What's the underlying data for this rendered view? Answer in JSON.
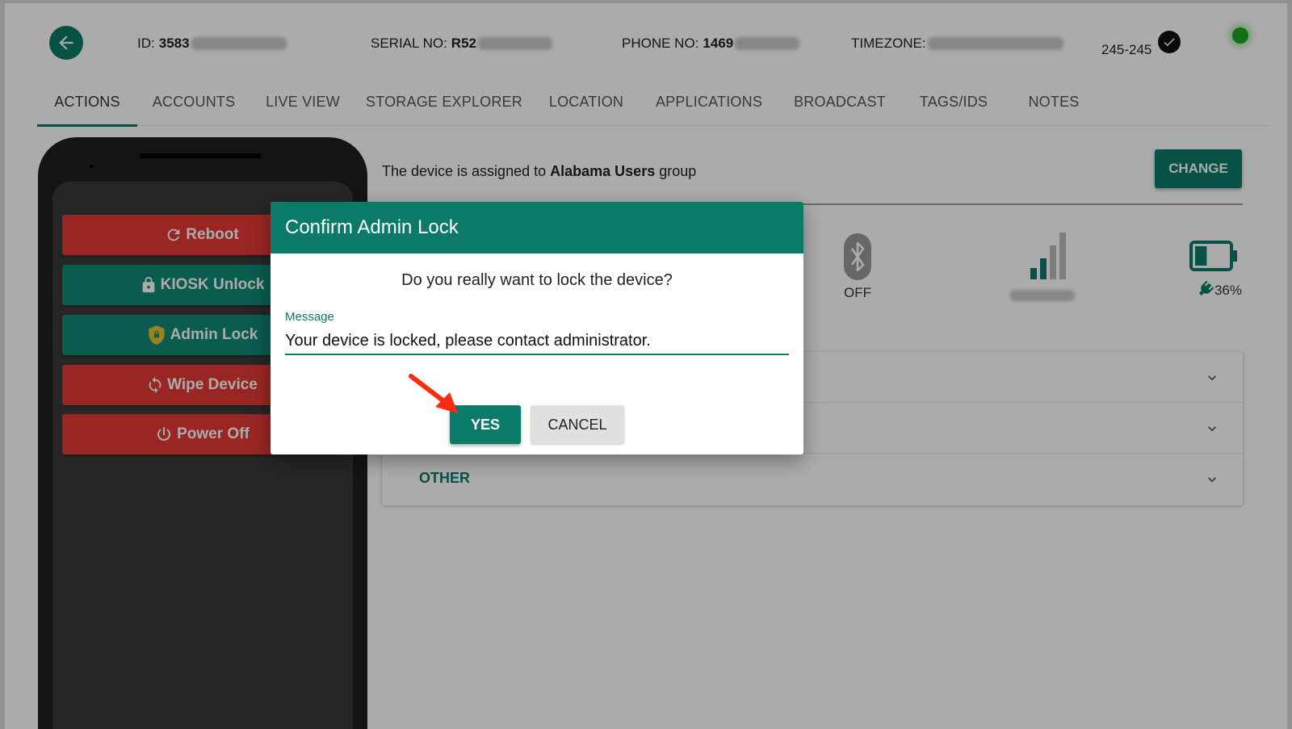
{
  "header": {
    "id_label": "ID:",
    "id_value": "3583",
    "serial_label": "SERIAL NO:",
    "serial_value": "R52",
    "phone_label": "PHONE NO:",
    "phone_value": "1469",
    "timezone_label": "TIMEZONE:",
    "version": "245-245",
    "status_color": "#1fa51f",
    "icons": [
      "arrow-left-icon",
      "check-circle-icon"
    ]
  },
  "tabs": [
    {
      "label": "ACTIONS",
      "active": true
    },
    {
      "label": "ACCOUNTS"
    },
    {
      "label": "LIVE VIEW"
    },
    {
      "label": "STORAGE EXPLORER"
    },
    {
      "label": "LOCATION"
    },
    {
      "label": "APPLICATIONS"
    },
    {
      "label": "BROADCAST"
    },
    {
      "label": "TAGS/IDS"
    },
    {
      "label": "NOTES"
    }
  ],
  "actions": [
    {
      "label": "Reboot",
      "icon": "refresh-icon",
      "color": "#e53935"
    },
    {
      "label": "KIOSK Unlock",
      "icon": "lock-icon",
      "color": "#0f8a76"
    },
    {
      "label": "Admin Lock",
      "icon": "shield-lock-icon",
      "color": "#0f8a76"
    },
    {
      "label": "Wipe Device",
      "icon": "sync-icon",
      "color": "#e53935"
    },
    {
      "label": "Power Off",
      "icon": "power-icon",
      "color": "#e53935"
    }
  ],
  "group": {
    "prefix": "The device is assigned to",
    "name": "Alabama Users",
    "suffix": "group",
    "change_label": "CHANGE"
  },
  "stats": {
    "bluetooth": "OFF",
    "battery": "36%",
    "battery_level": 0.36
  },
  "accordion": {
    "other_label": "OTHER"
  },
  "dialog": {
    "title": "Confirm Admin Lock",
    "question": "Do you really want to lock the device?",
    "message_label": "Message",
    "message_value": "Your device is locked, please contact administrator.",
    "yes_label": "YES",
    "cancel_label": "CANCEL"
  },
  "colors": {
    "accent": "#0b7a69",
    "danger": "#e53935",
    "arrow": "#ff2a12"
  }
}
